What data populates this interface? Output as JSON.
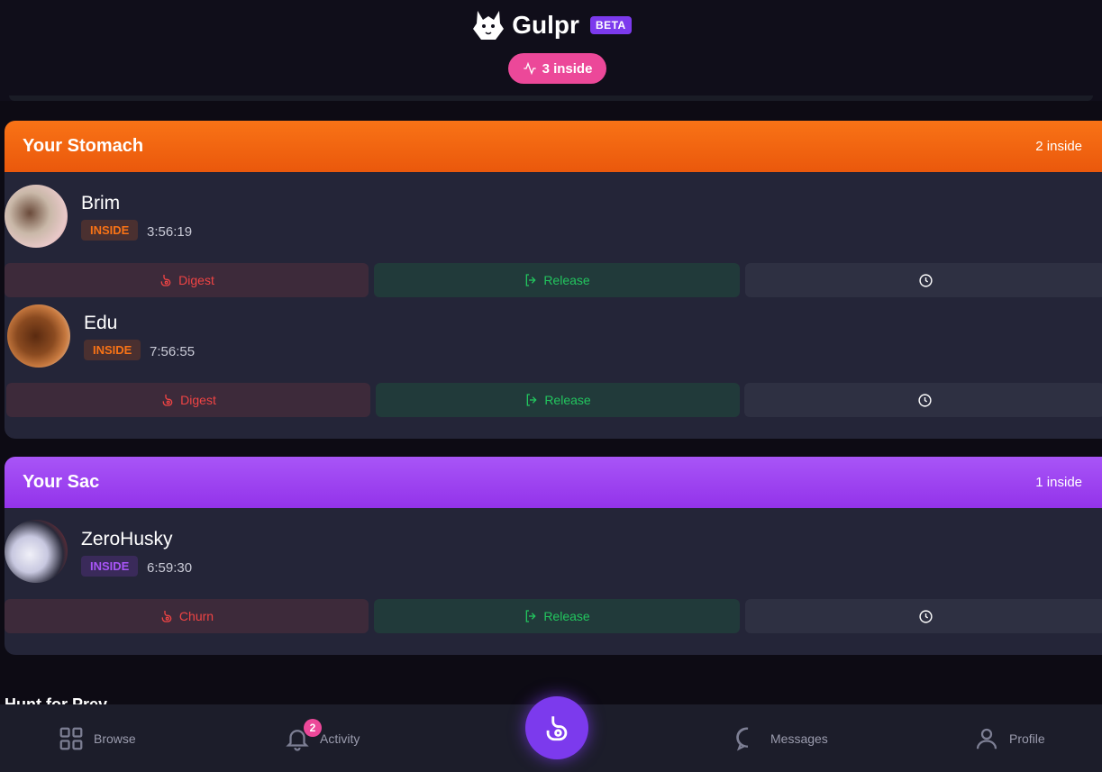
{
  "header": {
    "brand_name": "Gulpr",
    "beta_label": "BETA",
    "inside_pill": "3 inside"
  },
  "stomach": {
    "title": "Your Stomach",
    "count": "2 inside",
    "prey": [
      {
        "name": "Brim",
        "status": "INSIDE",
        "timer": "3:56:19",
        "action_label": "Digest",
        "release_label": "Release"
      },
      {
        "name": "Edu",
        "status": "INSIDE",
        "timer": "7:56:55",
        "action_label": "Digest",
        "release_label": "Release"
      }
    ]
  },
  "sac": {
    "title": "Your Sac",
    "count": "1 inside",
    "prey": [
      {
        "name": "ZeroHusky",
        "status": "INSIDE",
        "timer": "6:59:30",
        "action_label": "Churn",
        "release_label": "Release"
      }
    ]
  },
  "hunt_heading": "Hunt for Prey",
  "nav": {
    "browse": "Browse",
    "activity": "Activity",
    "activity_badge": "2",
    "messages": "Messages",
    "profile": "Profile"
  },
  "colors": {
    "stomach_accent": "#f97316",
    "sac_accent": "#a855f7",
    "pill": "#ec4899",
    "fab": "#7c3aed"
  }
}
